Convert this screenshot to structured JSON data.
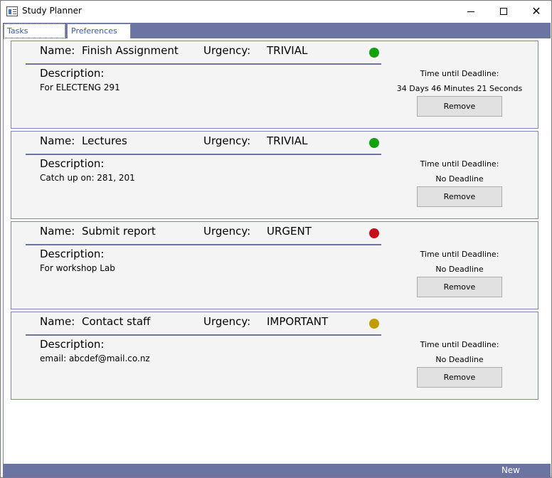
{
  "window": {
    "title": "Study Planner",
    "close_glyph": "✕"
  },
  "tabs": [
    {
      "label": "Tasks"
    },
    {
      "label": "Preferences"
    }
  ],
  "labels": {
    "name": "Name:",
    "urgency": "Urgency:",
    "description": "Description:",
    "deadline": "Time until Deadline:",
    "remove": "Remove"
  },
  "tasks": [
    {
      "name": "Finish Assignment",
      "urgency": "TRIVIAL",
      "urgency_color": "#13a10e",
      "description": "For ELECTENG 291",
      "deadline": "34 Days 46 Minutes 21 Seconds"
    },
    {
      "name": "Lectures",
      "urgency": "TRIVIAL",
      "urgency_color": "#13a10e",
      "description": "Catch up on: 281, 201",
      "deadline": "No Deadline"
    },
    {
      "name": "Submit report",
      "urgency": "URGENT",
      "urgency_color": "#c50f1f",
      "description": "For workshop Lab",
      "deadline": "No Deadline"
    },
    {
      "name": "Contact staff",
      "urgency": "IMPORTANT",
      "urgency_color": "#c19c00",
      "description": "email: abcdef@mail.co.nz",
      "deadline": "No Deadline"
    }
  ],
  "footer": {
    "new_label": "New"
  },
  "colors": {
    "accent": "#6b74a3",
    "card_bg": "#f4f4f4"
  },
  "icons": {
    "app": "app-window-icon",
    "minimize": "minimize-icon",
    "maximize": "maximize-icon",
    "close": "close-icon"
  }
}
